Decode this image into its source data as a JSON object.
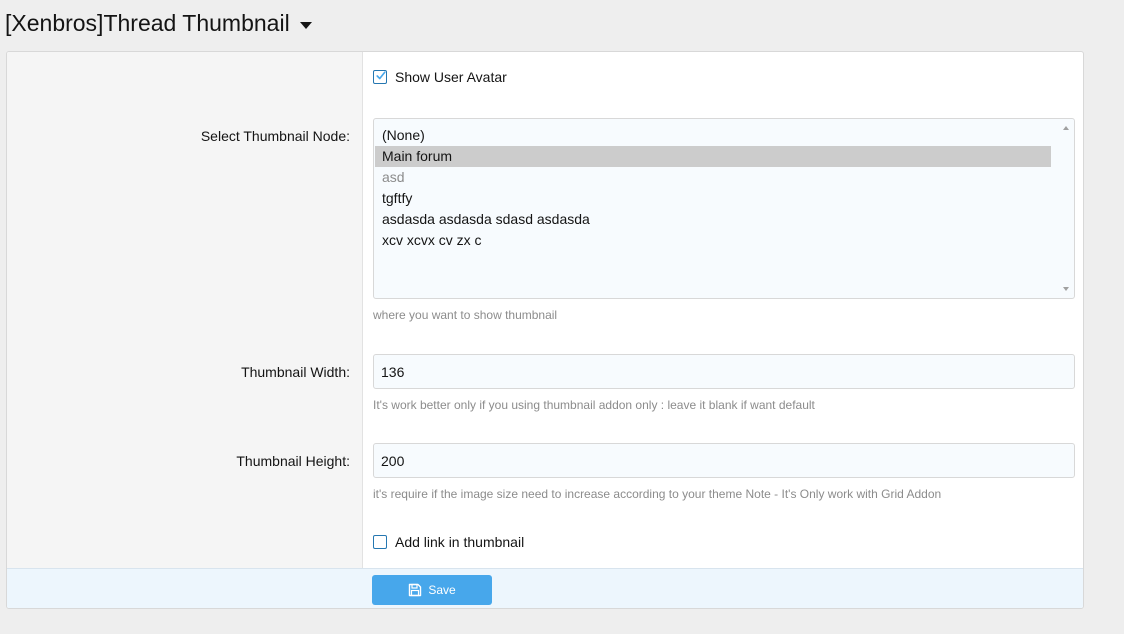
{
  "header": {
    "title": "[Xenbros]Thread Thumbnail"
  },
  "form": {
    "show_avatar": {
      "label": "Show User Avatar",
      "checked": true
    },
    "thumbnail_node": {
      "label": "Select Thumbnail Node:",
      "options": [
        {
          "label": "(None)",
          "selected": false,
          "disabled": false
        },
        {
          "label": "Main forum",
          "selected": true,
          "disabled": false
        },
        {
          "label": "asd",
          "selected": false,
          "disabled": true
        },
        {
          "label": "tgftfy",
          "selected": false,
          "disabled": false
        },
        {
          "label": "asdasda asdasda sdasd asdasda",
          "selected": false,
          "disabled": false
        },
        {
          "label": "xcv xcvx cv zx c",
          "selected": false,
          "disabled": false
        }
      ],
      "hint": "where you want to show thumbnail"
    },
    "thumbnail_width": {
      "label": "Thumbnail Width:",
      "value": "136",
      "hint": "It's work better only if you using thumbnail addon only : leave it blank if want default"
    },
    "thumbnail_height": {
      "label": "Thumbnail Height:",
      "value": "200",
      "hint": "it's require if the image size need to increase according to your theme Note - It's Only work with Grid Addon"
    },
    "add_link": {
      "label": "Add link in thumbnail",
      "checked": false
    },
    "save_label": "Save"
  },
  "colors": {
    "accent": "#47a7eb",
    "checkbox_border": "#2577b1",
    "selected_option": "#cccccc",
    "hint_text": "#8c8c8c"
  },
  "icons": {
    "title_menu": "caret-down-icon",
    "save": "floppy-disk-icon",
    "checked": "checkmark-icon"
  }
}
